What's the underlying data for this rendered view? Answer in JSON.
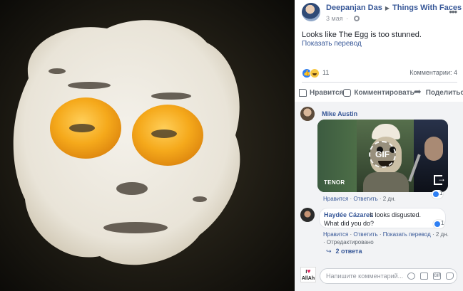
{
  "post": {
    "author": "Deepanjan Das",
    "group": "Things With Faces",
    "date": "3 мая",
    "text": "Looks like The Egg is too stunned.",
    "translate": "Показать перевод",
    "reaction_count": "11",
    "comments_count": "Комментарии: 4"
  },
  "actions": {
    "like": "Нравится",
    "comment": "Комментировать",
    "share": "Поделиться"
  },
  "comments": [
    {
      "name": "Mike Austin",
      "gif_badge": "GIF",
      "gif_source": "TENOR",
      "like": "Нравится",
      "reply": "Ответить",
      "time": "2 дн.",
      "likes": "1"
    },
    {
      "name": "Haydée Cázares",
      "text_line1": "It looks disgusted.",
      "text_line2": "What did you do?",
      "like": "Нравится",
      "reply": "Ответить",
      "translate": "Показать перевод",
      "time": "2 дн.",
      "likes": "1",
      "edited": "Отредактировано",
      "replies": "2 ответа"
    }
  ],
  "compose": {
    "placeholder": "Напишите комментарий...",
    "page_avatar_line1": "I",
    "page_avatar_line2": "AllAh"
  },
  "colors": {
    "link": "#385898",
    "like_blue": "#2e7ff3",
    "panel_bg": "#ffffff",
    "comments_bg": "#f2f3f5"
  }
}
